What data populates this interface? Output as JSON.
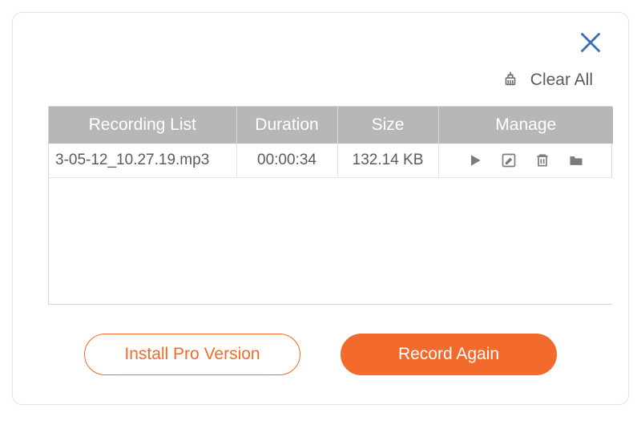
{
  "accent_color": "#f26a2c",
  "toolbar": {
    "clear_label": "Clear All"
  },
  "table": {
    "headers": {
      "name": "Recording List",
      "duration": "Duration",
      "size": "Size",
      "manage": "Manage"
    },
    "rows": [
      {
        "name": "3-05-12_10.27.19.mp3",
        "duration": "00:00:34",
        "size": "132.14 KB"
      }
    ]
  },
  "buttons": {
    "install_pro": "Install Pro Version",
    "record_again": "Record Again"
  }
}
